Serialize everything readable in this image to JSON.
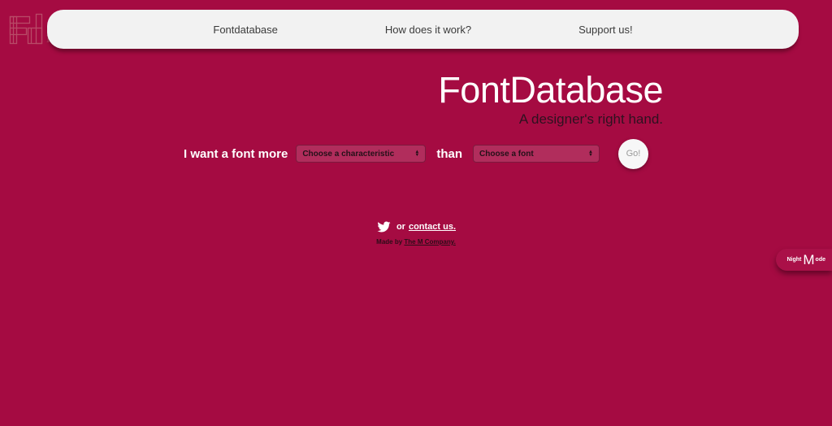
{
  "colors": {
    "background": "#a50b42",
    "navbar_bg": "#f2f2f2",
    "nav_text": "#3b3b3b",
    "title_text": "#ffffff",
    "tagline_text": "#2e1220",
    "select_bg_overlay": "rgba(255,255,255,0.14)",
    "go_button_bg": "#f7f7f7",
    "go_button_text": "#9a9a9a"
  },
  "logo": {
    "letters": "Fd",
    "serif_mark": "I"
  },
  "nav": {
    "items": [
      {
        "label": "Fontdatabase"
      },
      {
        "label": "How does it work?"
      },
      {
        "label": "Support us!"
      }
    ]
  },
  "hero": {
    "title": "FontDatabase",
    "tagline": "A designer's right hand."
  },
  "form": {
    "prefix_label": "I want a font more",
    "characteristic_select": {
      "value": "Choose a characteristic"
    },
    "than_label": "than",
    "font_select": {
      "value": "Choose a font"
    },
    "go_button": "Go!"
  },
  "social": {
    "or_label": "or",
    "contact_link": "contact us.",
    "made_by_prefix": "Made by",
    "company_link": "The M Company."
  },
  "night_mode": {
    "word_start": "Night",
    "big_letter": "M",
    "word_end": "ode"
  }
}
